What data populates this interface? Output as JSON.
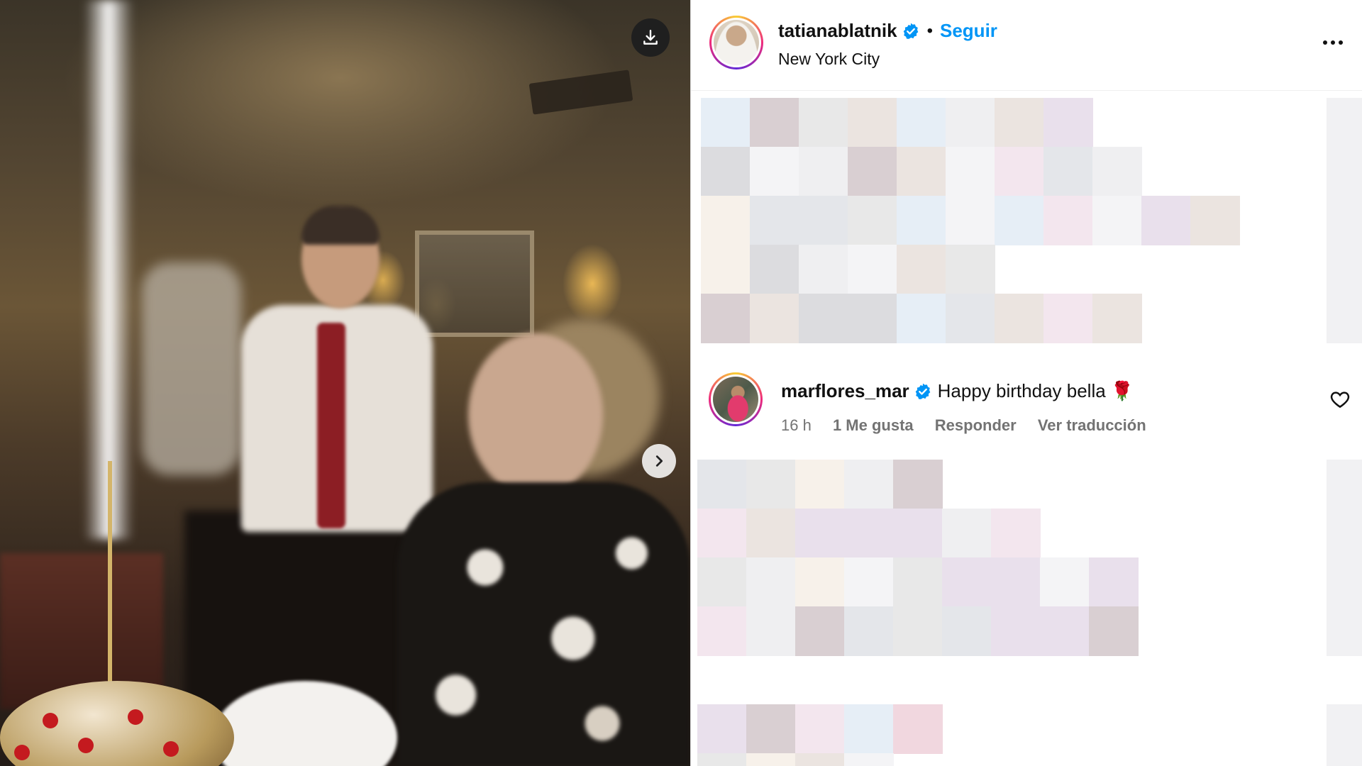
{
  "post": {
    "author": "tatianablatnik",
    "follow_label": "Seguir",
    "separator": "•",
    "location": "New York City"
  },
  "comment": {
    "author": "marflores_mar",
    "text": "Happy birthday bella 🌹",
    "time": "16 h",
    "likes": "1 Me gusta",
    "reply_label": "Responder",
    "translate_label": "Ver traducción"
  },
  "icons": {
    "download": "download-icon",
    "next": "chevron-right-icon",
    "more": "more-options-icon",
    "like": "heart-icon",
    "verified": "verified-badge-icon"
  },
  "colors": {
    "follow": "#0095f6",
    "verified": "#0095f6",
    "meta": "#737373"
  }
}
